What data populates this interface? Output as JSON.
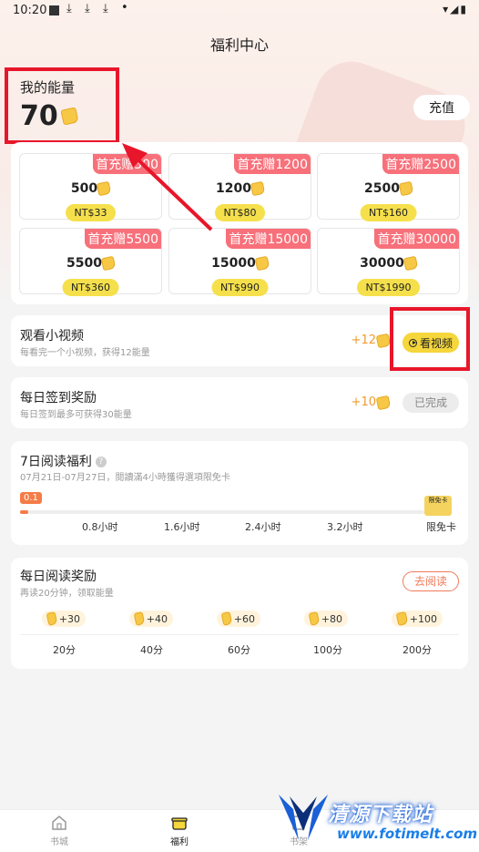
{
  "status_bar": {
    "time": "10:20"
  },
  "header": {
    "title": "福利中心"
  },
  "energy": {
    "label": "我的能量",
    "value": "70",
    "recharge_label": "充值"
  },
  "packs": [
    {
      "promo": "首充赠500",
      "amount": "500",
      "price": "NT$33"
    },
    {
      "promo": "首充赠1200",
      "amount": "1200",
      "price": "NT$80"
    },
    {
      "promo": "首充赠2500",
      "amount": "2500",
      "price": "NT$160"
    },
    {
      "promo": "首充赠5500",
      "amount": "5500",
      "price": "NT$360"
    },
    {
      "promo": "首充赠15000",
      "amount": "15000",
      "price": "NT$990"
    },
    {
      "promo": "首充赠30000",
      "amount": "30000",
      "price": "NT$1990"
    }
  ],
  "video_task": {
    "title": "观看小视频",
    "subtitle": "每看完一个小视频，获得12能量",
    "reward": "+12",
    "button_label": "看视频"
  },
  "signin_task": {
    "title": "每日签到奖励",
    "subtitle": "每日签到最多可获得30能量",
    "reward": "+10",
    "button_label": "已完成"
  },
  "reading_7day": {
    "title": "7日阅读福利",
    "subtitle": "07月21日-07月27日，閱讀滿4小時獲得選項限免卡",
    "progress_value": "0.1",
    "progress_fraction": 0.02,
    "ticks": [
      "0.8小时",
      "1.6小时",
      "2.4小时",
      "3.2小时",
      "限免卡"
    ],
    "card_label": "限免卡"
  },
  "daily_reading": {
    "title": "每日阅读奖励",
    "subtitle": "再读20分钟，领取能量",
    "button_label": "去阅读",
    "rewards": [
      "+30",
      "+40",
      "+60",
      "+80",
      "+100"
    ],
    "minutes": [
      "20分",
      "40分",
      "60分",
      "100分",
      "200分"
    ]
  },
  "bottom_nav": {
    "items": [
      "书城",
      "福利",
      "书架"
    ]
  },
  "watermark": {
    "line1": "清源下载站",
    "line2": "www.fotimelt.com"
  },
  "colors": {
    "accent_red": "#e8162a",
    "button_yellow": "#f5d63b",
    "promo_pink": "#f7707a"
  }
}
